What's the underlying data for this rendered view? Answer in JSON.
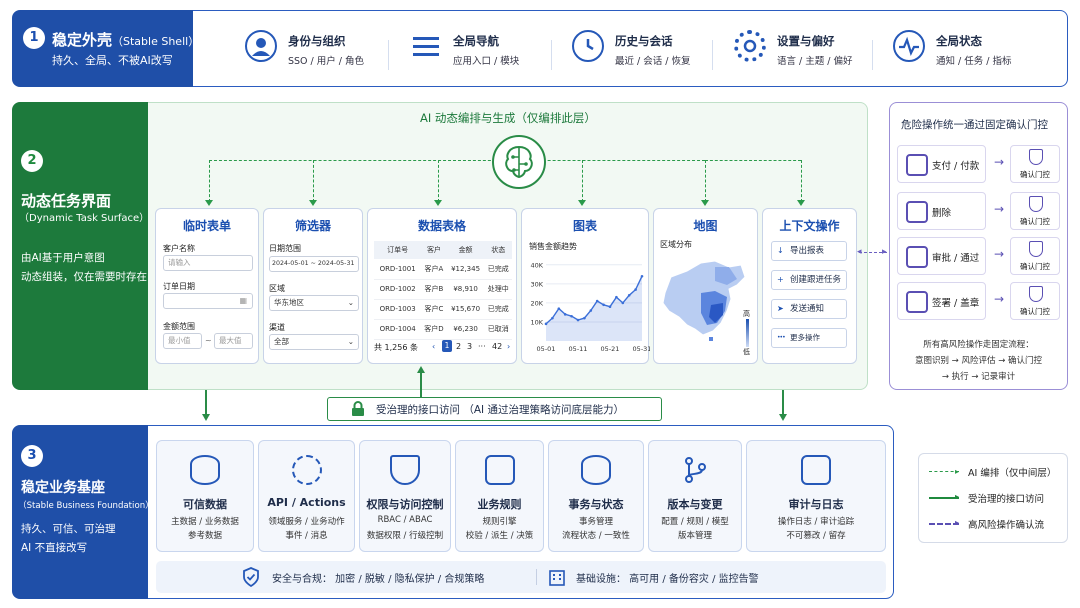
{
  "layer1": {
    "num": "1",
    "title": "稳定外壳",
    "title_en": "（Stable Shell）",
    "subtitle": "持久、全局、不被AI改写",
    "items": [
      {
        "icon": "user-icon",
        "title": "身份与组织",
        "sub": "SSO / 用户 / 角色"
      },
      {
        "icon": "menu-icon",
        "title": "全局导航",
        "sub": "应用入口 / 模块"
      },
      {
        "icon": "clock-icon",
        "title": "历史与会话",
        "sub": "最近 / 会话 / 恢复"
      },
      {
        "icon": "gear-icon",
        "title": "设置与偏好",
        "sub": "语言 / 主题 / 偏好"
      },
      {
        "icon": "pulse-icon",
        "title": "全局状态",
        "sub": "通知 / 任务 / 指标"
      }
    ]
  },
  "layer2": {
    "num": "2",
    "title": "动态任务界面",
    "title_en": "（Dynamic Task Surface）",
    "desc1": "由AI基于用户意图",
    "desc2": "动态组装，仅在需要时存在",
    "ai_title": "AI 动态编排与生成（仅编排此层）",
    "form": {
      "title": "临时表单",
      "name_label": "客户名称",
      "name_placeholder": "请输入",
      "date_label": "订单日期",
      "amount_label": "金额范围",
      "min_placeholder": "最小值",
      "tilde": "~",
      "max_placeholder": "最大值"
    },
    "filter": {
      "title": "筛选器",
      "date_label": "日期范围",
      "date_value": "2024-05-01 ~ 2024-05-31",
      "region_label": "区域",
      "region_value": "华东地区",
      "channel_label": "渠道",
      "channel_value": "全部"
    },
    "table": {
      "title": "数据表格",
      "headers": [
        "订单号",
        "客户",
        "金额",
        "状态"
      ],
      "rows": [
        [
          "ORD-1001",
          "客户A",
          "¥12,345",
          "已完成"
        ],
        [
          "ORD-1002",
          "客户B",
          "¥8,910",
          "处理中"
        ],
        [
          "ORD-1003",
          "客户C",
          "¥15,670",
          "已完成"
        ],
        [
          "ORD-1004",
          "客户D",
          "¥6,230",
          "已取消"
        ]
      ],
      "total": "共 1,256 条",
      "pages": [
        "1",
        "2",
        "3",
        "···",
        "42"
      ],
      "prev": "‹",
      "next": "›"
    },
    "chart": {
      "title": "图表",
      "subtitle": "销售金额趋势"
    },
    "map": {
      "title": "地图",
      "subtitle": "区域分布",
      "legend_high": "高",
      "legend_low": "低"
    },
    "actions": {
      "title": "上下文操作",
      "items": [
        "导出报表",
        "创建跟进任务",
        "发送通知",
        "更多操作"
      ],
      "icons": [
        "↓",
        "+",
        "➤",
        "•••"
      ]
    }
  },
  "chart_data": {
    "type": "area",
    "title": "销售金额趋势",
    "x": [
      "05-01",
      "05-03",
      "05-05",
      "05-07",
      "05-09",
      "05-11",
      "05-13",
      "05-15",
      "05-17",
      "05-19",
      "05-21",
      "05-23",
      "05-25",
      "05-27",
      "05-29",
      "05-31"
    ],
    "x_ticks": [
      "05-01",
      "05-11",
      "05-21",
      "05-31"
    ],
    "values": [
      9,
      12,
      17,
      14,
      13,
      11,
      12,
      16,
      21,
      19,
      18,
      23,
      20,
      24,
      27,
      34
    ],
    "y_ticks": [
      "10K",
      "20K",
      "30K",
      "40K"
    ],
    "ylim": [
      0,
      42
    ],
    "color": "#3b6fd8"
  },
  "governed": {
    "text": "受治理的接口访问 （AI 通过治理策略访问底层能力）"
  },
  "danger": {
    "title": "危险操作统一通过固定确认门控",
    "ops": [
      {
        "icon": "payment-icon",
        "label": "支付 / 付款"
      },
      {
        "icon": "trash-icon",
        "label": "删除"
      },
      {
        "icon": "approve-icon",
        "label": "审批 / 通过"
      },
      {
        "icon": "sign-icon",
        "label": "签署 / 盖章"
      }
    ],
    "gate_label": "确认门控",
    "arrow": "→",
    "flow_title": "所有高风险操作走固定流程：",
    "flow_line1": "意图识别 → 风险评估 → 确认门控",
    "flow_line2": "→ 执行 → 记录审计"
  },
  "layer3": {
    "num": "3",
    "title": "稳定业务基座",
    "title_en": "（Stable Business Foundation）",
    "desc1": "持久、可信、可治理",
    "desc2": "AI 不直接改写",
    "cards": [
      {
        "icon": "database-icon",
        "title": "可信数据",
        "sub1": "主数据 / 业务数据",
        "sub2": "参考数据"
      },
      {
        "icon": "cloud-gear-icon",
        "title": "API / Actions",
        "sub1": "领域服务 / 业务动作",
        "sub2": "事件 / 消息"
      },
      {
        "icon": "shield-user-icon",
        "title": "权限与访问控制",
        "sub1": "RBAC / ABAC",
        "sub2": "数据权限 / 行级控制"
      },
      {
        "icon": "doc-check-icon",
        "title": "业务规则",
        "sub1": "规则引擎",
        "sub2": "校验 / 派生 / 决策"
      },
      {
        "icon": "db-check-icon",
        "title": "事务与状态",
        "sub1": "事务管理",
        "sub2": "流程状态 / 一致性"
      },
      {
        "icon": "branch-icon",
        "title": "版本与变更",
        "sub1": "配置 / 规则 / 模型",
        "sub2": "版本管理"
      },
      {
        "icon": "clipboard-icon",
        "title": "审计与日志",
        "sub1": "操作日志 / 审计追踪",
        "sub2": "不可篡改 / 留存"
      }
    ],
    "security": "安全与合规：  加密 / 脱敏 / 隐私保护 / 合规策略",
    "infra": "基础设施：  高可用 / 备份容灾 / 监控告警"
  },
  "legend": {
    "items": [
      {
        "label": "AI 编排（仅中间层）",
        "color": "#2a9a4a",
        "style": "dashed"
      },
      {
        "label": "受治理的接口访问",
        "color": "#1f8a3e",
        "style": "solid"
      },
      {
        "label": "高风险操作确认流",
        "color": "#5a4fb3",
        "style": "dashed"
      }
    ]
  }
}
